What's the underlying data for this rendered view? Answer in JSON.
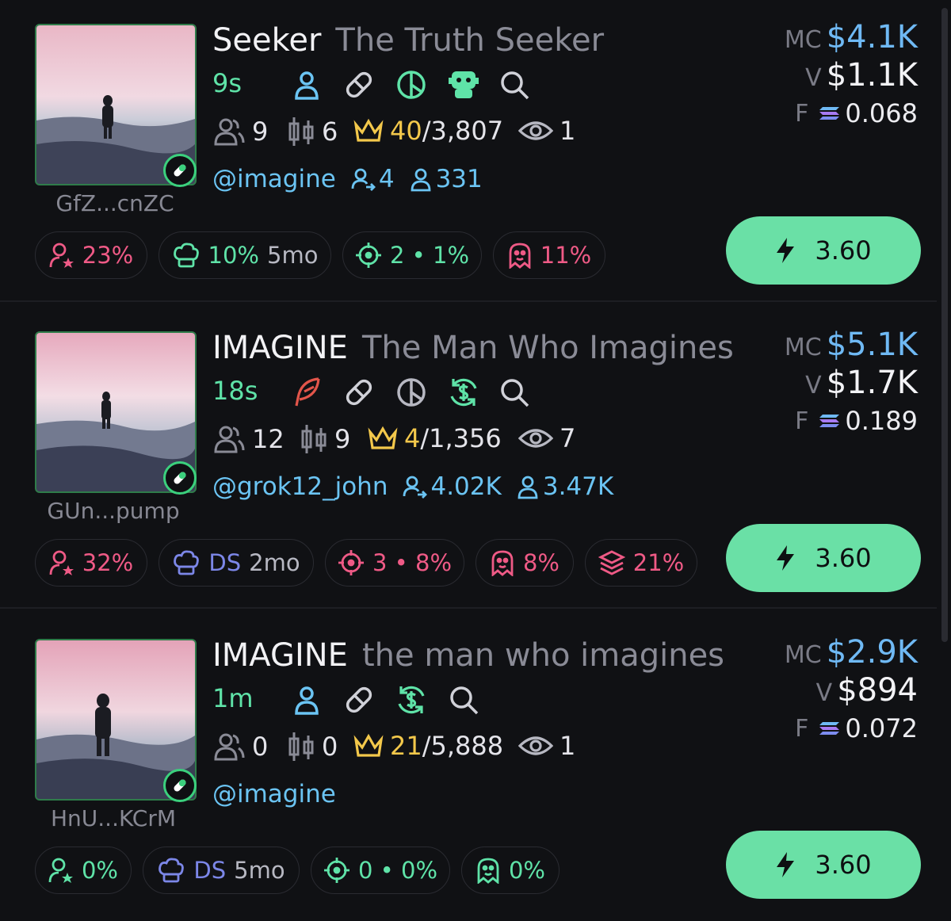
{
  "tokens": [
    {
      "ticker": "Seeker",
      "name": "The Truth Seeker",
      "age": "9s",
      "address": "GfZ...cnZC",
      "holders": "9",
      "pro_traders": "6",
      "rank_cur": "40",
      "rank_total": "/3,807",
      "watchers": "1",
      "handle": "@imagine",
      "followers_a": "4",
      "followers_b": "331",
      "mc": "$4.1K",
      "volume": "$1.1K",
      "fee": "0.068",
      "chip_top10": "23%",
      "chip_dev_label": "10%",
      "chip_dev_age": "5mo",
      "chip_snipers": "2 • 1%",
      "chip_insiders": "11%",
      "buy": "3.60",
      "icons": [
        "user-icon",
        "link-icon",
        "pie-chart-icon",
        "bot-icon",
        "search-icon"
      ]
    },
    {
      "ticker": "IMAGINE",
      "name": "The Man Who Imagines",
      "age": "18s",
      "address": "GUn...pump",
      "holders": "12",
      "pro_traders": "9",
      "rank_cur": "4",
      "rank_total": "/1,356",
      "watchers": "7",
      "handle": "@grok12_john",
      "followers_a": "4.02K",
      "followers_b": "3.47K",
      "mc": "$5.1K",
      "volume": "$1.7K",
      "fee": "0.189",
      "chip_top10": "32%",
      "chip_dev_label": "DS",
      "chip_dev_age": "2mo",
      "chip_snipers": "3 • 8%",
      "chip_insiders": "8%",
      "chip_bundles": "21%",
      "buy": "3.60",
      "icons": [
        "feather-icon",
        "link-icon",
        "pie-chart-icon",
        "dollar-cycle-icon",
        "search-icon"
      ]
    },
    {
      "ticker": "IMAGINE",
      "name": "the man who imagines",
      "age": "1m",
      "address": "HnU...KCrM",
      "holders": "0",
      "pro_traders": "0",
      "rank_cur": "21",
      "rank_total": "/5,888",
      "watchers": "1",
      "handle": "@imagine",
      "mc": "$2.9K",
      "volume": "$894",
      "fee": "0.072",
      "chip_top10": "0%",
      "chip_dev_label": "DS",
      "chip_dev_age": "5mo",
      "chip_snipers": "0 • 0%",
      "chip_insiders": "0%",
      "buy": "3.60",
      "icons": [
        "user-icon",
        "link-icon",
        "dollar-cycle-icon",
        "search-icon"
      ]
    }
  ],
  "labels": {
    "mc": "MC",
    "v": "V",
    "f": "F"
  },
  "colors": {
    "accent_green": "#6ae0a6",
    "link_blue": "#6bc4f3",
    "warn_pink": "#ef5a86",
    "gold": "#f3c84b"
  }
}
